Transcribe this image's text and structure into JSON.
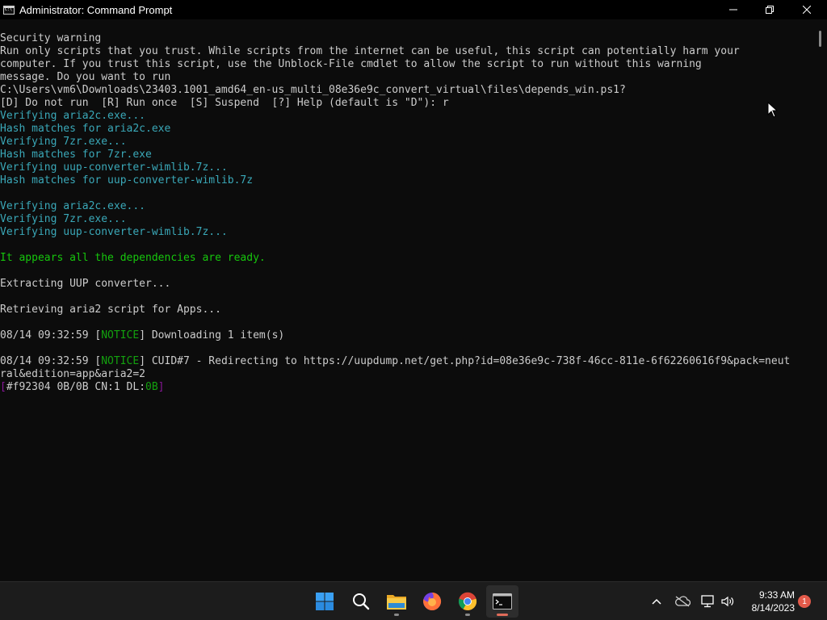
{
  "window": {
    "title": "Administrator: Command Prompt",
    "icon": "cmd-icon"
  },
  "console": {
    "lines": [
      {
        "segments": [
          {
            "text": "Security warning",
            "color": "white"
          }
        ]
      },
      {
        "segments": [
          {
            "text": "Run only scripts that you trust. While scripts from the internet can be useful, this script can potentially harm your",
            "color": "white"
          }
        ]
      },
      {
        "segments": [
          {
            "text": "computer. If you trust this script, use the Unblock-File cmdlet to allow the script to run without this warning",
            "color": "white"
          }
        ]
      },
      {
        "segments": [
          {
            "text": "message. Do you want to run",
            "color": "white"
          }
        ]
      },
      {
        "segments": [
          {
            "text": "C:\\Users\\vm6\\Downloads\\23403.1001_amd64_en-us_multi_08e36e9c_convert_virtual\\files\\depends_win.ps1?",
            "color": "white"
          }
        ]
      },
      {
        "segments": [
          {
            "text": "[D] Do not run  [R] Run once  [S] Suspend  [?] Help (default is \"D\"): r",
            "color": "white"
          }
        ]
      },
      {
        "segments": [
          {
            "text": "Verifying aria2c.exe...",
            "color": "teal"
          }
        ]
      },
      {
        "segments": [
          {
            "text": "Hash matches for aria2c.exe",
            "color": "teal"
          }
        ]
      },
      {
        "segments": [
          {
            "text": "Verifying 7zr.exe...",
            "color": "teal"
          }
        ]
      },
      {
        "segments": [
          {
            "text": "Hash matches for 7zr.exe",
            "color": "teal"
          }
        ]
      },
      {
        "segments": [
          {
            "text": "Verifying uup-converter-wimlib.7z...",
            "color": "teal"
          }
        ]
      },
      {
        "segments": [
          {
            "text": "Hash matches for uup-converter-wimlib.7z",
            "color": "teal"
          }
        ]
      },
      {
        "segments": []
      },
      {
        "segments": [
          {
            "text": "Verifying aria2c.exe...",
            "color": "teal"
          }
        ]
      },
      {
        "segments": [
          {
            "text": "Verifying 7zr.exe...",
            "color": "teal"
          }
        ]
      },
      {
        "segments": [
          {
            "text": "Verifying uup-converter-wimlib.7z...",
            "color": "teal"
          }
        ]
      },
      {
        "segments": []
      },
      {
        "segments": [
          {
            "text": "It appears all the dependencies are ready.",
            "color": "green"
          }
        ]
      },
      {
        "segments": []
      },
      {
        "segments": [
          {
            "text": "Extracting UUP converter...",
            "color": "white"
          }
        ]
      },
      {
        "segments": []
      },
      {
        "segments": [
          {
            "text": "Retrieving aria2 script for Apps...",
            "color": "white"
          }
        ]
      },
      {
        "segments": []
      },
      {
        "segments": [
          {
            "text": "08/14 09:32:59 [",
            "color": "white"
          },
          {
            "text": "NOTICE",
            "color": "green2"
          },
          {
            "text": "] Downloading 1 item(s)",
            "color": "white"
          }
        ]
      },
      {
        "segments": []
      },
      {
        "segments": [
          {
            "text": "08/14 09:32:59 [",
            "color": "white"
          },
          {
            "text": "NOTICE",
            "color": "green2"
          },
          {
            "text": "] CUID#7 - Redirecting to https://uupdump.net/get.php?id=08e36e9c-738f-46cc-811e-6f62260616f9&pack=neut",
            "color": "white"
          }
        ]
      },
      {
        "segments": [
          {
            "text": "ral&edition=app&aria2=2",
            "color": "white"
          }
        ]
      },
      {
        "segments": [
          {
            "text": "[",
            "color": "purple"
          },
          {
            "text": "#f92304 0B/0B CN:1 DL:",
            "color": "white"
          },
          {
            "text": "0B",
            "color": "green2"
          },
          {
            "text": "]",
            "color": "purple"
          }
        ]
      }
    ]
  },
  "taskbar": {
    "apps": [
      {
        "name": "start-button",
        "icon": "windows-logo-icon"
      },
      {
        "name": "search-button",
        "icon": "search-icon"
      },
      {
        "name": "file-explorer-button",
        "icon": "folder-icon"
      },
      {
        "name": "firefox-button",
        "icon": "firefox-icon"
      },
      {
        "name": "chrome-button",
        "icon": "chrome-icon"
      },
      {
        "name": "terminal-button",
        "icon": "terminal-icon"
      }
    ],
    "clock_time": "9:33 AM",
    "clock_date": "8/14/2023",
    "notification_count": "1"
  },
  "colors": {
    "white": "#cccccc",
    "teal": "#3aa8b8",
    "green": "#16c60c",
    "green2": "#13a10e",
    "purple": "#881798"
  }
}
